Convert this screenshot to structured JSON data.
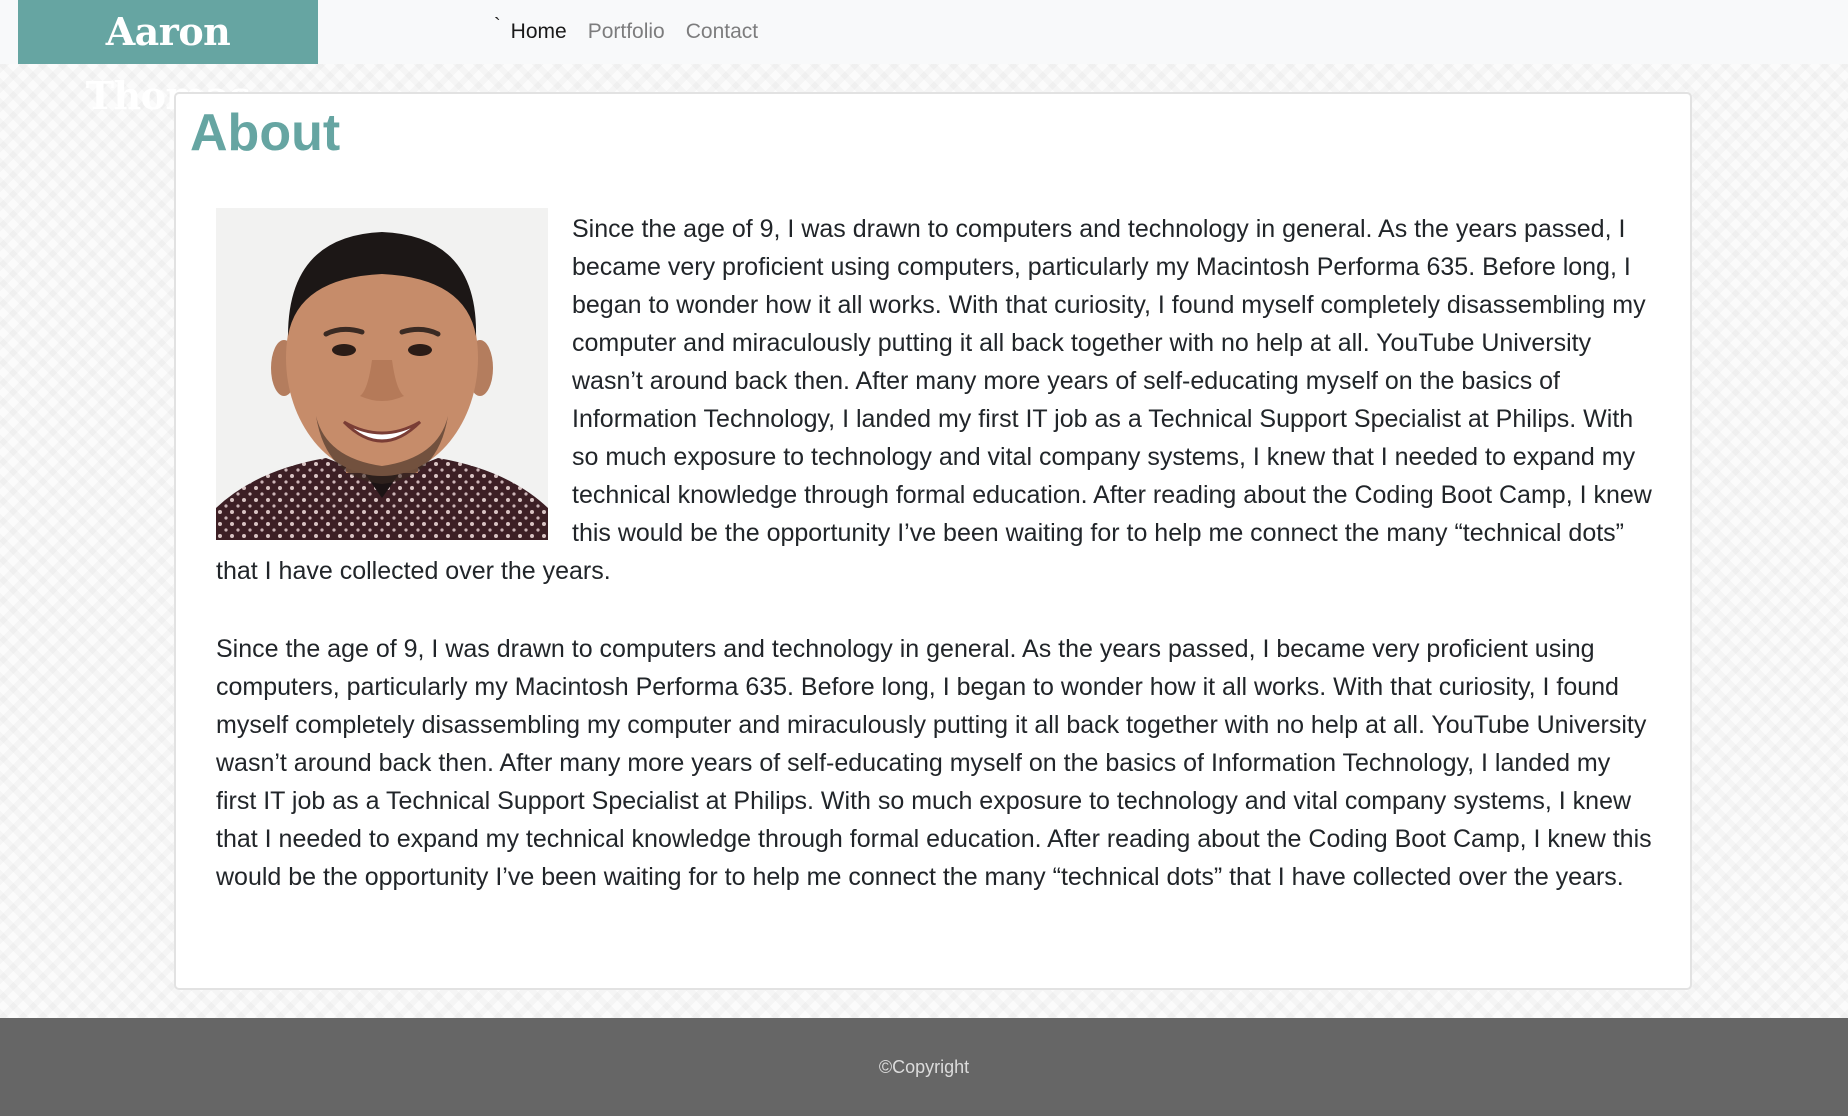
{
  "brand": "Aaron Thomas",
  "nav": {
    "tick": "`",
    "items": [
      {
        "label": "Home",
        "active": true
      },
      {
        "label": "Portfolio",
        "active": false
      },
      {
        "label": "Contact",
        "active": false
      }
    ]
  },
  "about": {
    "title": "About",
    "paragraphs": [
      "Since the age of 9, I was drawn to computers and technology in general. As the years passed, I became very proficient using computers, particularly my Macintosh Performa 635. Before long, I began to wonder how it all works. With that curiosity, I found myself completely disassembling my computer and miraculously putting it all back together with no help at all. YouTube University wasn’t around back then. After many more years of self-educating myself on the basics of Information Technology, I landed my first IT job as a Technical Support Specialist at Philips. With so much exposure to technology and vital company systems, I knew that I needed to expand my technical knowledge through formal education. After reading about the Coding Boot Camp, I knew this would be the opportunity I’ve been waiting for to help me connect the many “technical dots” that I have collected over the years.",
      "Since the age of 9, I was drawn to computers and technology in general. As the years passed, I became very proficient using computers, particularly my Macintosh Performa 635. Before long, I began to wonder how it all works. With that curiosity, I found myself completely disassembling my computer and miraculously putting it all back together with no help at all. YouTube University wasn’t around back then. After many more years of self-educating myself on the basics of Information Technology, I landed my first IT job as a Technical Support Specialist at Philips. With so much exposure to technology and vital company systems, I knew that I needed to expand my technical knowledge through formal education. After reading about the Coding Boot Camp, I knew this would be the opportunity I’ve been waiting for to help me connect the many “technical dots” that I have collected over the years."
    ]
  },
  "footer": {
    "text": "©Copyright"
  },
  "colors": {
    "accent": "#66a5a2",
    "navbar_bg": "#f8f9fa",
    "footer_bg": "#666666"
  }
}
